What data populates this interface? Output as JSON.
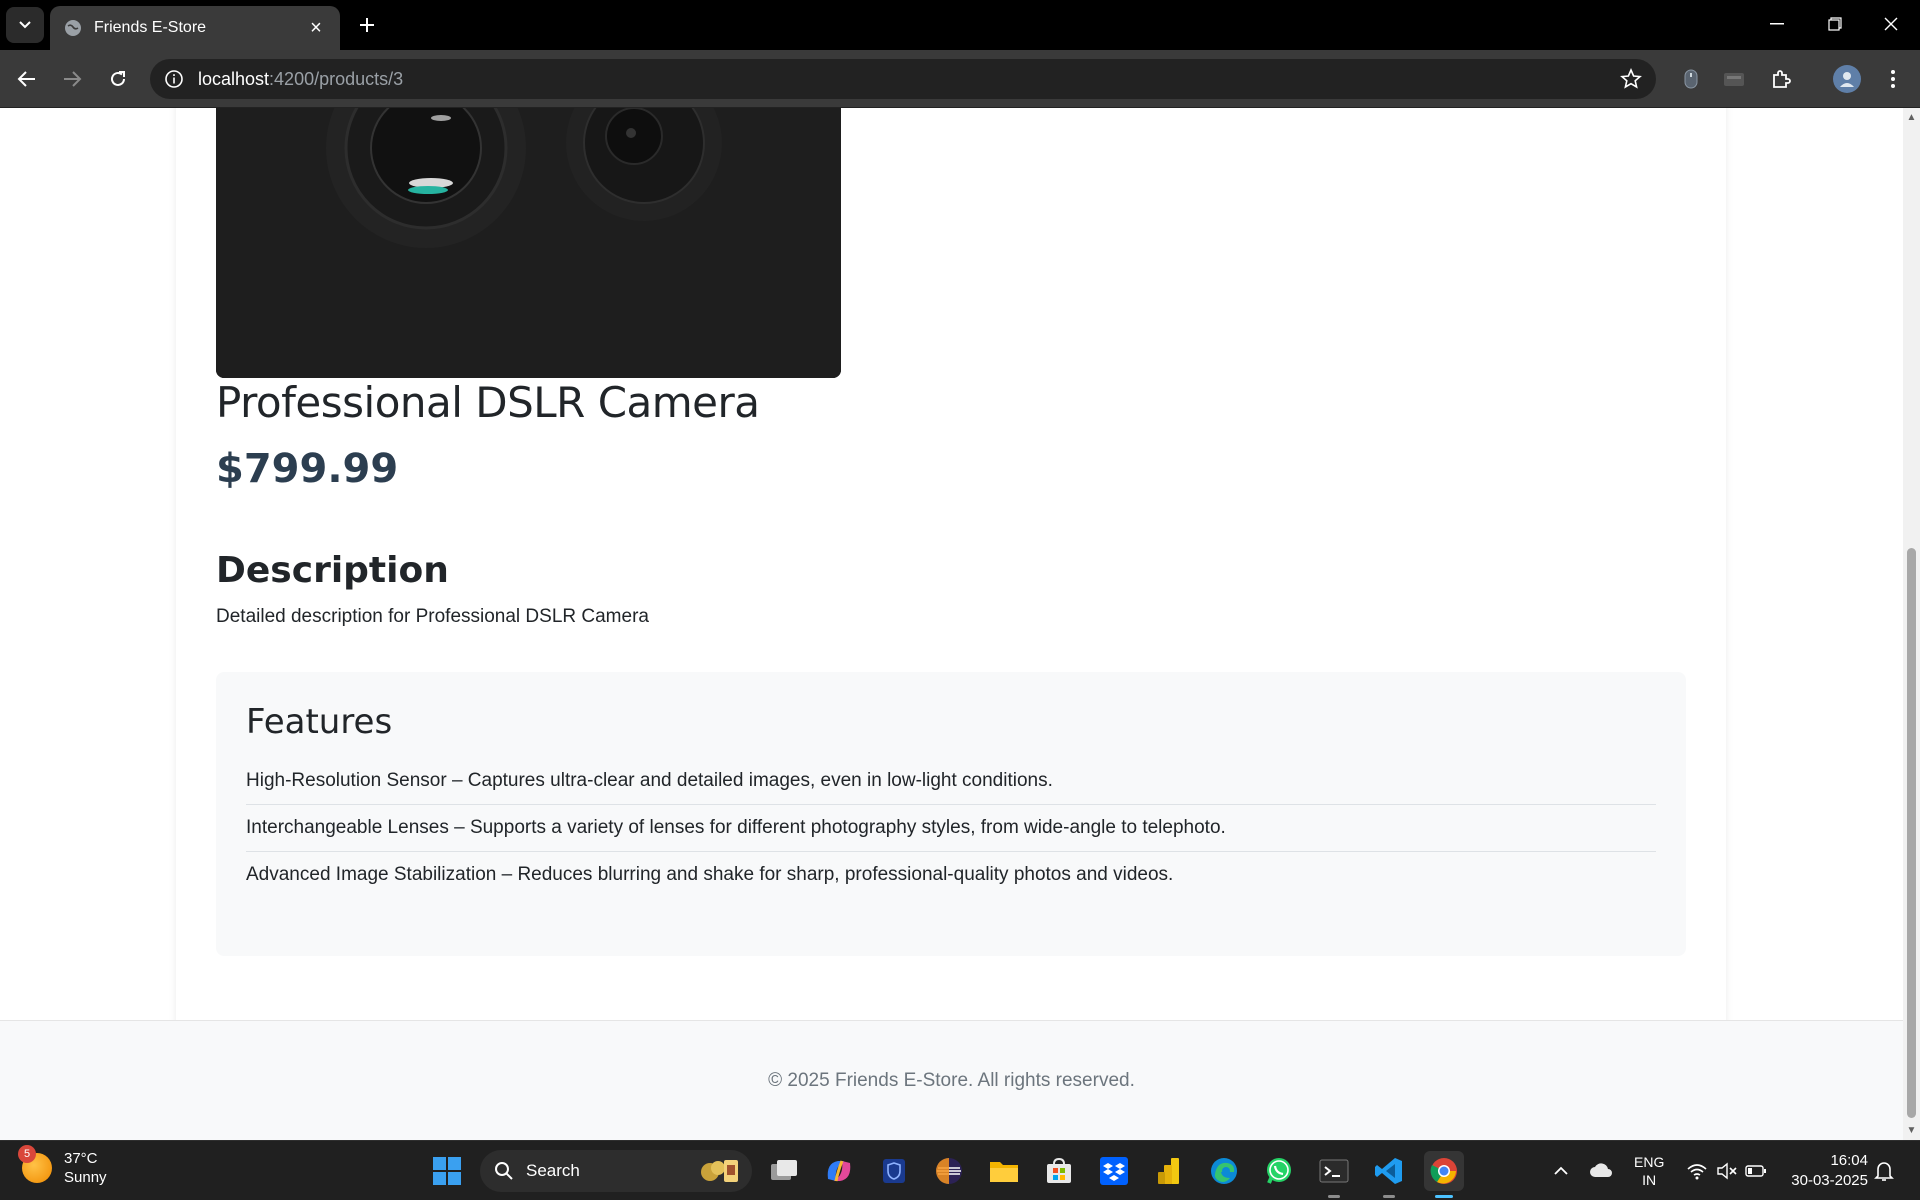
{
  "browser": {
    "tab_title": "Friends E-Store",
    "url_host": "localhost",
    "url_path": ":4200/products/3"
  },
  "product": {
    "name": "Professional DSLR Camera",
    "price": "$799.99",
    "description_heading": "Description",
    "description": "Detailed description for Professional DSLR Camera",
    "features_heading": "Features",
    "features": [
      "High-Resolution Sensor – Captures ultra-clear and detailed images, even in low-light conditions.",
      "Interchangeable Lenses – Supports a variety of lenses for different photography styles, from wide-angle to telephoto.",
      "Advanced Image Stabilization – Reduces blurring and shake for sharp, professional-quality photos and videos."
    ]
  },
  "footer": {
    "copyright": "© 2025 Friends E-Store. All rights reserved."
  },
  "taskbar": {
    "weather_badge": "5",
    "temperature": "37°C",
    "condition": "Sunny",
    "search_label": "Search",
    "lang_primary": "ENG",
    "lang_secondary": "IN",
    "time": "16:04",
    "date": "30-03-2025"
  },
  "colors": {
    "price": "#2c3e50",
    "features_bg": "#f8f9fa",
    "chrome_bg": "#3a3a3a"
  }
}
